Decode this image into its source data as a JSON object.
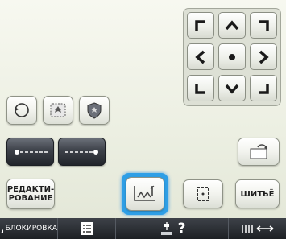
{
  "buttons": {
    "edit_label": "РЕДАКТИ-\nРОВАНИЕ",
    "sew_label": "ШИТЬЁ",
    "lock_label": "БЛОКИРОВКА",
    "help_glyph": "?"
  },
  "icons": {
    "arrows": [
      "arrow-up-left-icon",
      "arrow-up-icon",
      "arrow-up-right-icon",
      "arrow-left-icon",
      "center-dot-icon",
      "arrow-right-icon",
      "arrow-down-left-icon",
      "arrow-down-icon",
      "arrow-down-right-icon"
    ]
  },
  "colors": {
    "selection_ring": "#2f9fe6",
    "background": "#eef0e5",
    "bottom_bar": "#2a2d33",
    "warning": "#ffffff"
  }
}
